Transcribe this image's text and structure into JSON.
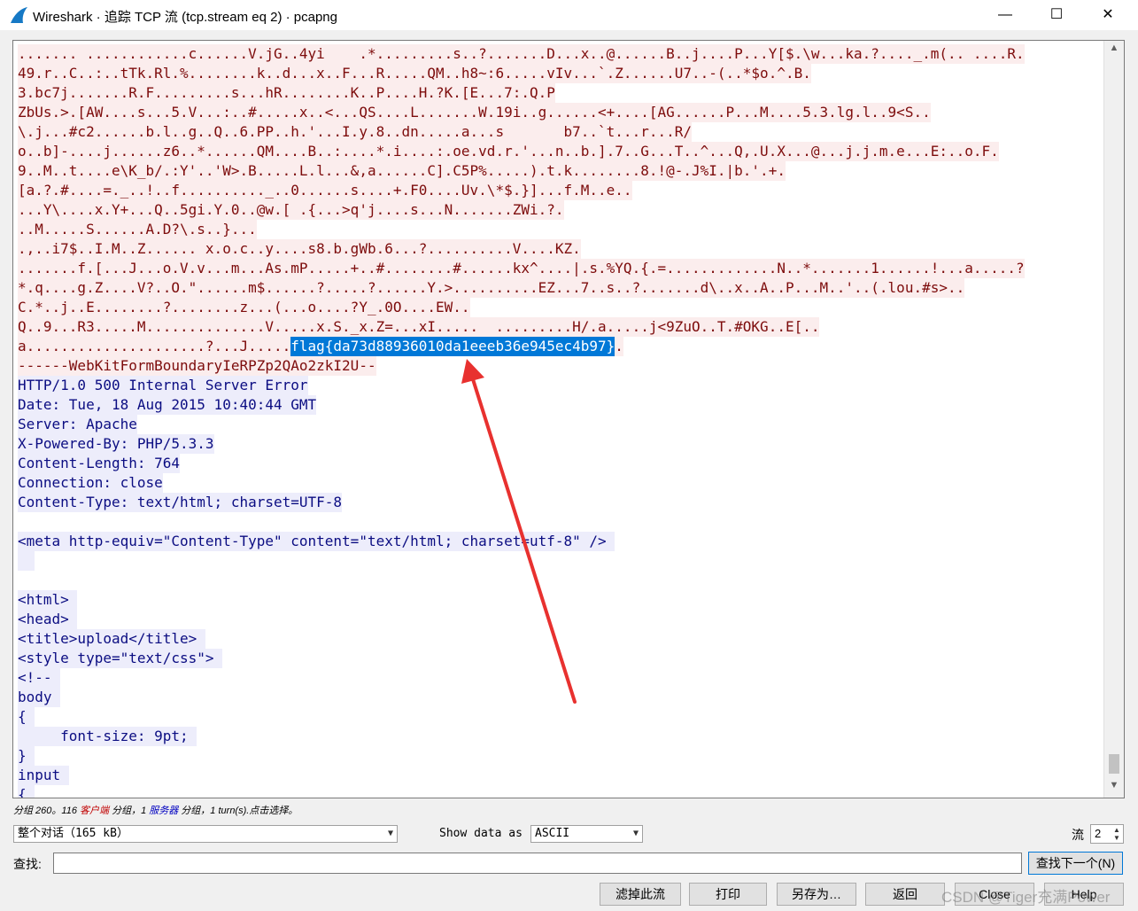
{
  "window": {
    "title": "Wireshark · 追踪 TCP 流 (tcp.stream eq 2) · pcapng",
    "minimize": "—",
    "maximize": "☐",
    "close": "✕"
  },
  "stream": {
    "lines": [
      [
        {
          "t": "....... ............c......V.jG..4yi    .*.........s..?.......D...x..@......B..j....P...Y[$.\\w...ka.?...._.m(.. ....R.",
          "c": "c"
        }
      ],
      [
        {
          "t": "49.r..C..:..tTk.Rl.%........k..d...x..F...R.....QM..h8~:6.....vIv...`.Z......U7..-(..*$o.^.B.",
          "c": "c"
        }
      ],
      [
        {
          "t": "3.bc7j.......R.F.........s...hR........K..P....H.?K.[E...7:.Q.P",
          "c": "c"
        }
      ],
      [
        {
          "t": "ZbUs.>.[AW....s...5.V...:..#.....x..<...QS....L.......W.19i..g......<+....[AG......P...M....5.3.lg.l..9<S..",
          "c": "c"
        }
      ],
      [
        {
          "t": "\\.j...#c2......b.l..g..Q..6.PP..h.'...I.y.8..dn.....a...s       b7..`t...r...R/",
          "c": "c"
        }
      ],
      [
        {
          "t": "o..b]-....j......z6..*......QM....B..:....*.i....:.oe.vd.r.'...n..b.].7..G...T..^...Q,.U.X...@...j.j.m.e...E:..o.F.",
          "c": "c"
        }
      ],
      [
        {
          "t": "9..M..t....e\\K_b/.:Y'..'W>.B.....L.l...&,a......C].C5P%.....).t.k........8.!@-.J%I.|b.'.+.",
          "c": "c"
        }
      ],
      [
        {
          "t": "[a.?.#....=._..!..f.........._..0......s....+.F0....Uv.\\*$.}]...f.M..e..",
          "c": "c"
        }
      ],
      [
        {
          "t": "...Y\\....x.Y+...Q..5gi.Y.0..@w.[ .{...>q'j....s...N.......ZWi.?.",
          "c": "c"
        }
      ],
      [
        {
          "t": "..M.....S......A.D?\\.s..}...",
          "c": "c"
        }
      ],
      [
        {
          "t": ".,..i7$..I.M..Z...... x.o.c..y....s8.b.gWb.6...?..........V....KZ.",
          "c": "c"
        }
      ],
      [
        {
          "t": ".......f.[...J...o.V.v...m...As.mP.....+..#........#......kx^....|.s.%YQ.{.=.............N..*.......1......!...a.....?",
          "c": "c"
        }
      ],
      [
        {
          "t": "*.q....g.Z....V?..O.\"......m$......?.....?......Y.>..........EZ...7..s..?.......d\\..x..A..P...M..'..(.lou.#s>..",
          "c": "c"
        }
      ],
      [
        {
          "t": "C.*..j..E........?........z...(...o....?Y_.0O....EW..",
          "c": "c"
        }
      ],
      [
        {
          "t": "Q..9...R3.....M..............V.....x.S._x.Z=...xI.....  .........H/.a.....j<9ZuO..T.#OKG..E[..",
          "c": "c"
        }
      ],
      [
        {
          "t": "a.....................?...J.....",
          "c": "c"
        },
        {
          "t": "flag{da73d88936010da1eeeb36e945ec4b97}",
          "c": "hl"
        },
        {
          "t": ".",
          "c": "c"
        }
      ],
      [
        {
          "t": "------WebKitFormBoundaryIeRPZp2QAo2zkI2U--",
          "c": "c"
        }
      ],
      [
        {
          "t": "HTTP/1.0 500 Internal Server Error",
          "c": "s"
        }
      ],
      [
        {
          "t": "Date: Tue, 18 Aug 2015 10:40:44 GMT",
          "c": "s"
        }
      ],
      [
        {
          "t": "Server: Apache",
          "c": "s"
        }
      ],
      [
        {
          "t": "X-Powered-By: PHP/5.3.3",
          "c": "s"
        }
      ],
      [
        {
          "t": "Content-Length: 764",
          "c": "s"
        }
      ],
      [
        {
          "t": "Connection: close",
          "c": "s"
        }
      ],
      [
        {
          "t": "Content-Type: text/html; charset=UTF-8",
          "c": "s"
        }
      ],
      [
        {
          "t": "",
          "c": "s"
        }
      ],
      [
        {
          "t": "<meta http-equiv=\"Content-Type\" content=\"text/html; charset=utf-8\" /> ",
          "c": "s"
        }
      ],
      [
        {
          "t": "  ",
          "c": "s"
        }
      ],
      [
        {
          "t": "",
          "c": "s"
        }
      ],
      [
        {
          "t": "<html> ",
          "c": "s"
        }
      ],
      [
        {
          "t": "<head> ",
          "c": "s"
        }
      ],
      [
        {
          "t": "<title>upload</title> ",
          "c": "s"
        }
      ],
      [
        {
          "t": "<style type=\"text/css\"> ",
          "c": "s"
        }
      ],
      [
        {
          "t": "<!-- ",
          "c": "s"
        }
      ],
      [
        {
          "t": "body ",
          "c": "s"
        }
      ],
      [
        {
          "t": "{ ",
          "c": "s"
        }
      ],
      [
        {
          "t": "     font-size: 9pt; ",
          "c": "s"
        }
      ],
      [
        {
          "t": "} ",
          "c": "s"
        }
      ],
      [
        {
          "t": "input ",
          "c": "s"
        }
      ],
      [
        {
          "t": "{ ",
          "c": "s"
        }
      ]
    ]
  },
  "status": {
    "part1": "分组 260。116 ",
    "client": "客户端",
    "part2": " 分组，1 ",
    "server": "服务器",
    "part3": " 分组，1 turn(s).点击选择。"
  },
  "controls": {
    "conversation": "整个对话（165 kB）",
    "show_data_as_label": "Show data as",
    "format": "ASCII",
    "stream_label": "流",
    "stream_number": "2",
    "find_label": "查找:",
    "find_value": "",
    "find_next": "查找下一个(N)"
  },
  "buttons": {
    "filter_out": "滤掉此流",
    "print": "打印",
    "save_as": "另存为…",
    "back": "返回",
    "close": "Close",
    "help": "Help"
  },
  "watermark": "CSDN @Tiger充满Power",
  "colors": {
    "client_bg": "#fbeded",
    "client_fg": "#7d0c0c",
    "server_bg": "#ededfb",
    "server_fg": "#0b0d82",
    "highlight": "#0078d7",
    "arrow": "#e8312f"
  }
}
